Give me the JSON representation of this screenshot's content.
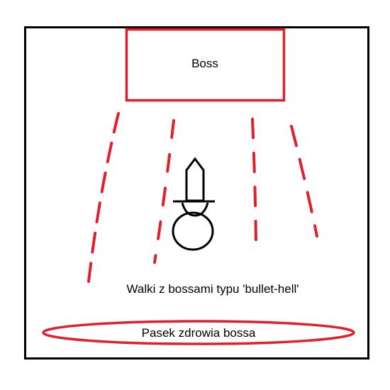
{
  "boss": {
    "label": "Boss"
  },
  "caption": "Walki z bossami typu 'bullet-hell'",
  "health_bar": {
    "label": "Pasek zdrowia bossa"
  },
  "colors": {
    "frame": "#000000",
    "accent": "#e0202a",
    "background": "#ffffff"
  },
  "icons": {
    "player": "sword-and-circle-player-icon",
    "projectiles": "dashed-bullet-trail"
  }
}
